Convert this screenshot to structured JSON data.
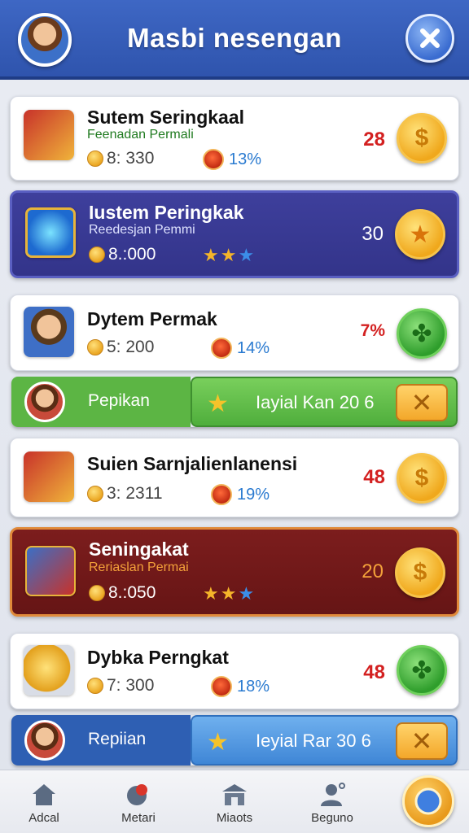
{
  "header": {
    "title": "Masbi nesengan",
    "close_icon": "close-icon"
  },
  "rows": [
    {
      "title": "Sutem Seringkaal",
      "subtitle": "Feenadan Permali",
      "coins": "8: 330",
      "percent": "13%",
      "score": "28",
      "badge": "dollar",
      "theme": "white"
    },
    {
      "title": "Iustem Peringkak",
      "subtitle": "Reedesjan Pemmi",
      "coins": "8.:000",
      "score": "30",
      "badge": "star",
      "theme": "purple"
    },
    {
      "title": "Dytem Permak",
      "coins": "5: 200",
      "percent": "14%",
      "score": "7%",
      "badge": "leaf",
      "theme": "white"
    },
    {
      "title": "Suien Sarnjalienlanensi",
      "coins": "3: 2311",
      "percent": "19%",
      "score": "48",
      "badge": "dollar",
      "theme": "white"
    },
    {
      "title": "Seningakat",
      "subtitle": "Reriaslan Permai",
      "coins": "8.:050",
      "score": "20",
      "badge": "dollar",
      "theme": "maroon"
    },
    {
      "title": "Dybka Perngkat",
      "coins": "7: 300",
      "percent": "18%",
      "score": "48",
      "badge": "leaf",
      "theme": "white"
    }
  ],
  "banners": [
    {
      "label": "Pepikan",
      "text": "Iayial Kan 20 6",
      "x_label": "✕"
    },
    {
      "label": "Repiian",
      "text": "Ieyial Rar 30 6",
      "x_label": "✕"
    }
  ],
  "nav": [
    {
      "label": "Adcal",
      "icon": "home-icon"
    },
    {
      "label": "Metari",
      "icon": "target-icon"
    },
    {
      "label": "Miaots",
      "icon": "shop-icon"
    },
    {
      "label": "Beguno",
      "icon": "profile-icon"
    }
  ],
  "colors": {
    "header": "#3e67c4",
    "score_red": "#d32020",
    "pct_blue": "#2a7ad0",
    "banner_green": "#5cb544",
    "banner_blue": "#2e5fb3"
  }
}
